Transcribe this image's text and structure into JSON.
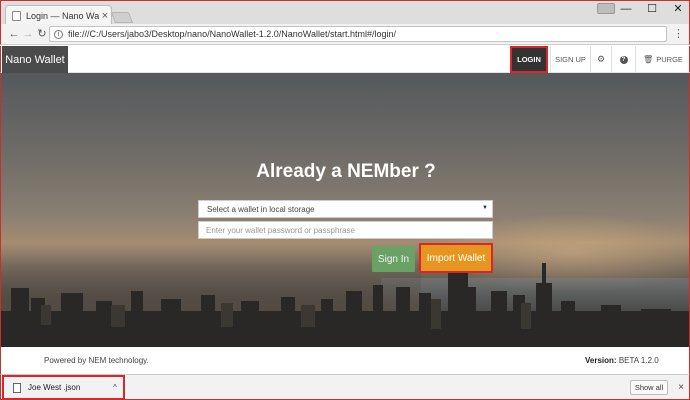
{
  "browser": {
    "tab_title": "Login — Nano Wallet",
    "tab_close": "×",
    "url": "file:///C:/Users/jabo3/Desktop/nano/NanoWallet-1.2.0/NanoWallet/start.html#/login/",
    "icons": {
      "back": "back-arrow-icon",
      "forward": "forward-arrow-icon",
      "reload": "reload-icon",
      "info": "info-icon",
      "menu": "more-vertical-icon"
    },
    "window_controls": {
      "minimize": "—",
      "maximize": "☐",
      "close": "✕"
    }
  },
  "nav": {
    "brand": "Nano Wallet",
    "login": "LOGIN",
    "signup": "SIGN UP",
    "purge": "PURGE",
    "settings_icon": "gear-icon",
    "help_icon": "question-circle-icon",
    "purge_icon": "trash-icon"
  },
  "login": {
    "title": "Already a NEMber ?",
    "wallet_select_value": "Select a wallet in local storage",
    "password_placeholder": "Enter your wallet password or passphrase",
    "sign_in": "Sign In",
    "import_wallet": "Import Wallet"
  },
  "footer": {
    "powered_by": "Powered by NEM technology.",
    "version_label": "Version:",
    "version_value": "BETA 1.2.0"
  },
  "downloads": {
    "file_name": "Joe West .json",
    "show_all": "Show all",
    "close": "×"
  },
  "colors": {
    "highlight": "#d9262c",
    "import_button": "#e6961e",
    "sign_in_button": "#6aa165",
    "brand_bg": "#4b4b4b"
  }
}
